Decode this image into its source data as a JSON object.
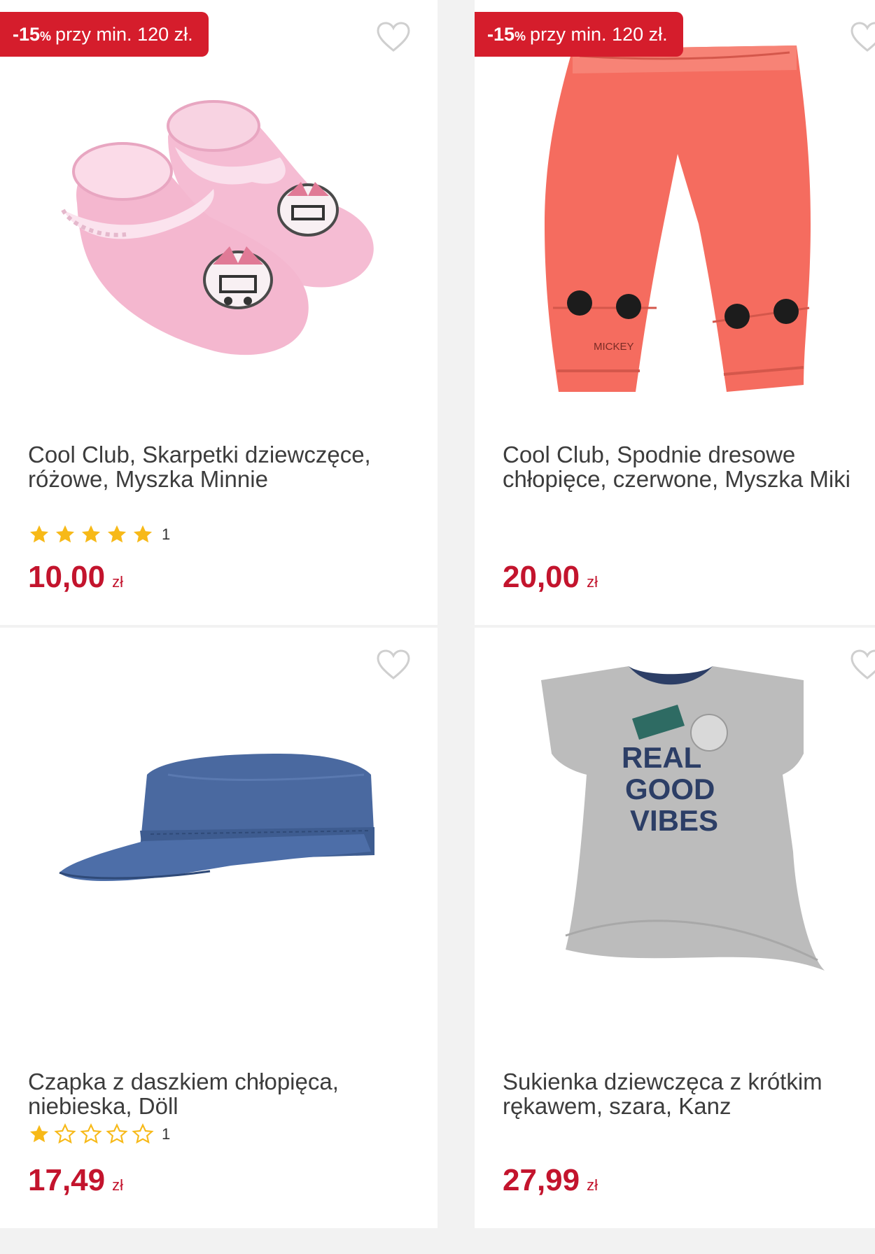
{
  "colors": {
    "accent": "#d51d2c",
    "price": "#c3142d",
    "star": "#f7b918",
    "background": "#f2f2f2"
  },
  "products": [
    {
      "badge": {
        "pct": "-15",
        "pct_suffix": "%",
        "text": "przy min. 120 zł."
      },
      "title": "Cool Club, Skarpetki dziewczęce, różowe, Myszka Minnie",
      "rating": {
        "stars": 5,
        "max": 5,
        "count": "1"
      },
      "price": {
        "amount": "10,00",
        "currency": "zł"
      },
      "image_icon": "pink-baby-socks"
    },
    {
      "badge": {
        "pct": "-15",
        "pct_suffix": "%",
        "text": "przy min. 120 zł."
      },
      "title": "Cool Club, Spodnie dresowe chłopięce, czerwone, Myszka Miki",
      "print_text": "MICKEY",
      "price": {
        "amount": "20,00",
        "currency": "zł"
      },
      "image_icon": "red-sweatpants"
    },
    {
      "title": "Czapka z daszkiem chłopięca, niebieska, Döll",
      "rating": {
        "stars": 1,
        "max": 5,
        "count": "1"
      },
      "price": {
        "amount": "17,49",
        "currency": "zł"
      },
      "image_icon": "blue-cap"
    },
    {
      "title": "Sukienka dziewczęca z krótkim rękawem, szara, Kanz",
      "print_text": [
        "REAL",
        "GOOD",
        "VIBES"
      ],
      "price": {
        "amount": "27,99",
        "currency": "zł"
      },
      "image_icon": "grey-dress"
    }
  ]
}
